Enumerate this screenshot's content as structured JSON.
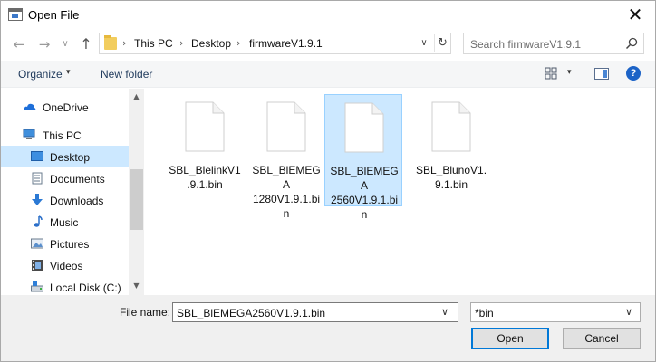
{
  "window": {
    "title": "Open File",
    "close_glyph": "✕"
  },
  "nav": {
    "back": "←",
    "forward": "→",
    "recent": "∨",
    "up": "↑"
  },
  "address": {
    "folder_icon": "folder-icon",
    "crumbs": [
      "This PC",
      "Desktop",
      "firmwareV1.9.1"
    ],
    "separator": "›",
    "dropdown": "∨",
    "refresh": "↻"
  },
  "search": {
    "placeholder": "Search firmwareV1.9.1",
    "icon": "search-icon"
  },
  "toolbar": {
    "organize": "Organize",
    "caret": "▾",
    "new_folder": "New folder",
    "view_caret": "▾",
    "help": "?"
  },
  "sidebar": {
    "items": [
      {
        "label": "OneDrive",
        "icon": "cloud-icon",
        "selected": false
      },
      {
        "label": "This PC",
        "icon": "computer-icon",
        "selected": false
      },
      {
        "label": "Desktop",
        "icon": "desktop-icon",
        "selected": true
      },
      {
        "label": "Documents",
        "icon": "documents-icon",
        "selected": false
      },
      {
        "label": "Downloads",
        "icon": "download-icon",
        "selected": false
      },
      {
        "label": "Music",
        "icon": "music-icon",
        "selected": false
      },
      {
        "label": "Pictures",
        "icon": "pictures-icon",
        "selected": false
      },
      {
        "label": "Videos",
        "icon": "videos-icon",
        "selected": false
      },
      {
        "label": "Local Disk (C:)",
        "icon": "disk-icon",
        "selected": false
      }
    ],
    "scroll_up": "▲",
    "scroll_down": "▼"
  },
  "files": [
    {
      "name_lines": [
        "SBL_BlelinkV1",
        ".9.1.bin",
        ""
      ],
      "selected": false
    },
    {
      "name_lines": [
        "SBL_BlEMEGA",
        "1280V1.9.1.bi",
        "n"
      ],
      "selected": false
    },
    {
      "name_lines": [
        "SBL_BlEMEGA",
        "2560V1.9.1.bi",
        "n"
      ],
      "selected": true
    },
    {
      "name_lines": [
        "SBL_BlunoV1.",
        "9.1.bin",
        ""
      ],
      "selected": false
    }
  ],
  "footer": {
    "file_name_label": "File name:",
    "file_name_value": "SBL_BlEMEGA2560V1.9.1.bin",
    "file_name_caret": "∨",
    "filter_value": "*bin",
    "filter_caret": "∨",
    "open_label": "Open",
    "cancel_label": "Cancel"
  },
  "colors": {
    "accent": "#0078d7",
    "selection": "#cce8ff",
    "selection_border": "#99d1ff",
    "folder": "#f2cd5e"
  }
}
